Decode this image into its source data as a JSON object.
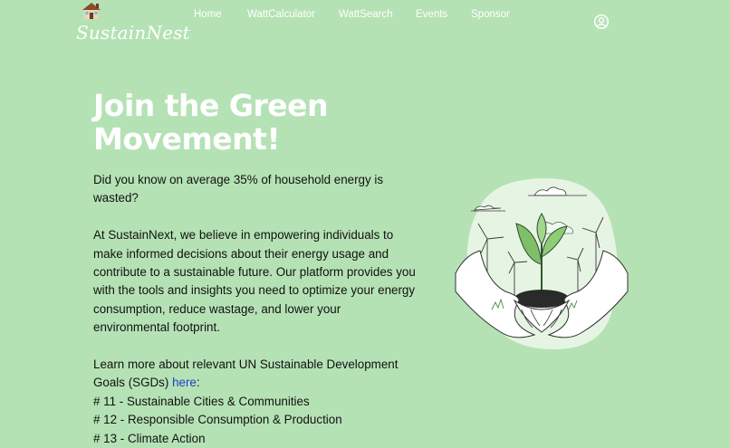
{
  "brand": {
    "name": "SustainNest",
    "logo_icon": "house-icon"
  },
  "nav": {
    "items": [
      {
        "label": "Home"
      },
      {
        "label": "WattCalculator"
      },
      {
        "label": "WattSearch"
      },
      {
        "label": "Events"
      },
      {
        "label": "Sponsor"
      }
    ],
    "profile_icon": "user-circle-icon"
  },
  "hero": {
    "title_line1": "Join the Green",
    "title_line2": "Movement!",
    "intro": "Did you know on average 35% of household energy is wasted?",
    "about": "At SustainNext, we believe in empowering individuals to make informed decisions about their energy usage and contribute to a sustainable future. Our platform provides you with the tools and insights you need to optimize your energy consumption, reduce wastage, and lower your environmental footprint.",
    "sdg_intro": "Learn more about relevant UN Sustainable Development Goals (SGDs)",
    "sdg_link": "here",
    "sdg_suffix": ":",
    "goals": [
      "# 11 - Sustainable Cities & Communities",
      "# 12 - Responsible Consumption & Production",
      "# 13 - Climate Action"
    ]
  },
  "colors": {
    "background": "#b5e2b5",
    "title": "#ffffff",
    "link": "#1a3fd0"
  },
  "illustration": {
    "icon": "hands-holding-seedling-icon"
  }
}
